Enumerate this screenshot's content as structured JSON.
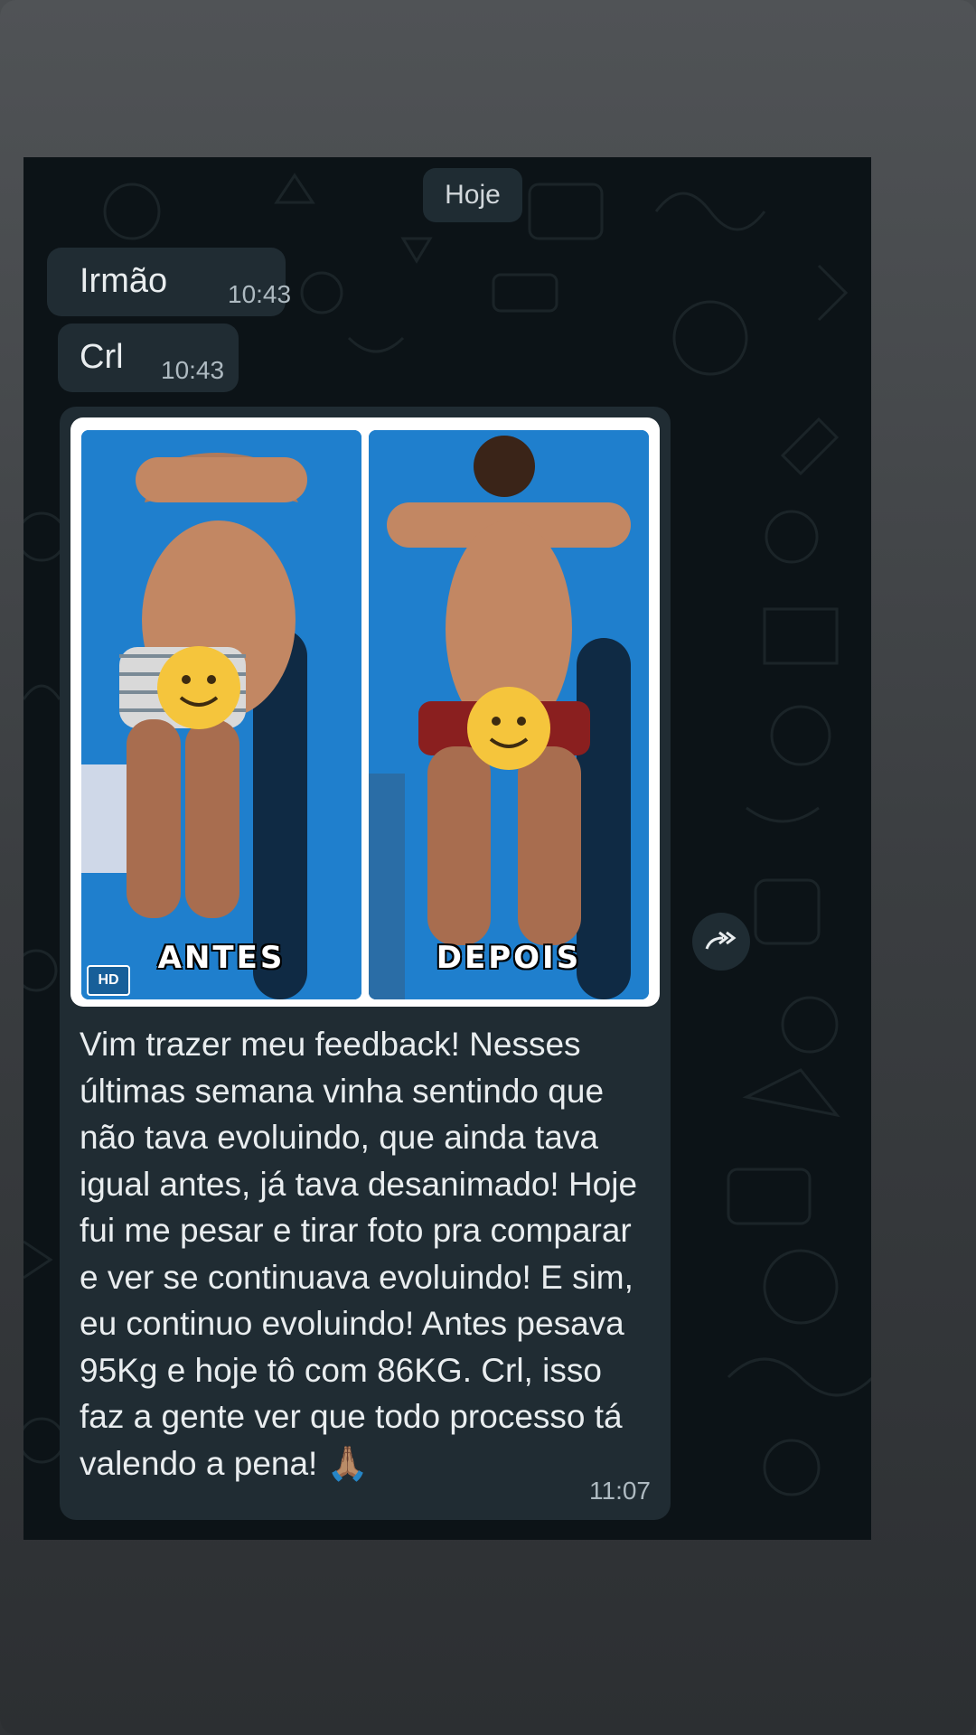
{
  "chat": {
    "date_chip": "Hoje",
    "messages": [
      {
        "text": "Irmão",
        "time": "10:43"
      },
      {
        "text": "Crl",
        "time": "10:43"
      }
    ],
    "media_message": {
      "photos": [
        {
          "label": "ANTES",
          "badge": "HD"
        },
        {
          "label": "DEPOIS"
        }
      ],
      "caption": "Vim trazer meu feedback! Nesses últimas semana vinha sentindo que não tava evoluindo, que ainda tava igual antes, já tava desanimado! Hoje  fui me pesar e tirar foto pra comparar e ver se continuava evoluindo! E sim, eu continuo evoluindo! Antes pesava 95Kg e hoje tô com 86KG. Crl, isso faz a gente ver que todo processo tá valendo a pena! 🙏🏽",
      "time": "11:07"
    },
    "forward_icon": "forward-icon"
  },
  "colors": {
    "chat_background": "#0c1317",
    "bubble": "#202c33",
    "text": "#e9edef",
    "meta_text": "#aebac1",
    "photo_wall": "#1d7fc8"
  }
}
